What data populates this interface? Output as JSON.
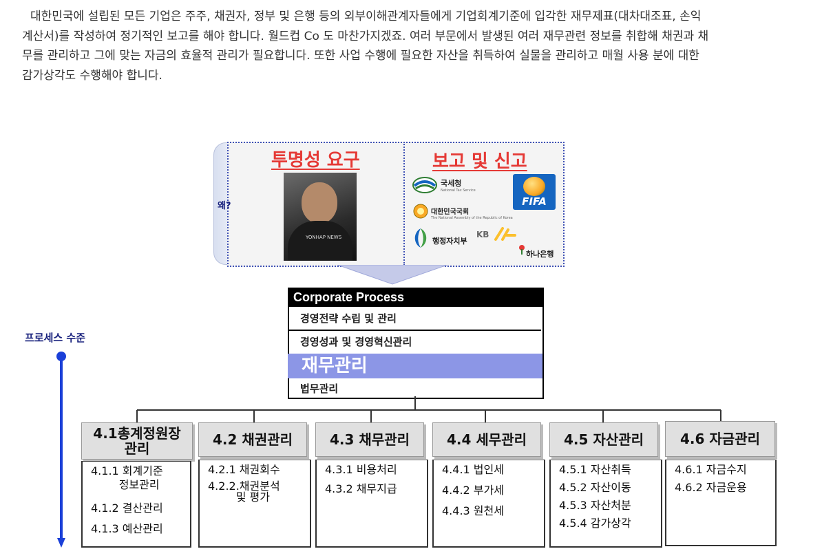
{
  "intro": {
    "lines": [
      "대한민국에  설립된 모든 기업은 주주, 채권자, 정부 및 은행 등의 외부이해관계자들에게 기업회계기준에 입각한 재무제표(대차대조표, 손익",
      "계산서)를 작성하여 정기적인 보고를 해야 합니다. 월드컵 Co 도 마찬가지겠죠. 여러 부문에서 발생된 여러 재무관련 정보를 취합해 채권과 채",
      "무를 관리하고 그에 맞는 자금의 효율적 관리가 필요합니다. 또한 사업 수행에 필요한 자산을 취득하여 실물을 관리하고 매월 사용 분에 대한",
      "감가상각도 수행해야 합니다."
    ]
  },
  "panel": {
    "why_label": "왜?",
    "left_header": "투명성 요구",
    "right_header": "보고 및 신고",
    "photo_caption": "YONHAP NEWS",
    "logos": {
      "nts": "국세청",
      "nts_en": "National Tax Service",
      "assembly": "대한민국국회",
      "assembly_en": "The National Assembly of the Republic of Korea",
      "mogaha": "행정자치부",
      "kb": "KB",
      "hana": "하나은행",
      "fifa": "FIFA"
    }
  },
  "process": {
    "title": "Corporate Process",
    "rows": [
      "경영전략 수립 및 관리",
      "경영성과 및 경영혁신관리",
      "재무관리",
      "법무관리"
    ]
  },
  "level_label": "프로세스 수준",
  "cards": [
    {
      "title": "4.1총계정원장\n관리",
      "items": [
        "4.1.1 회계기준\n        정보관리",
        "4.1.2 결산관리",
        "4.1.3 예산관리"
      ]
    },
    {
      "title": "4.2 채권관리",
      "items": [
        "4.2.1 채권회수",
        "4.2.2.채권분석\n        및 평가"
      ]
    },
    {
      "title": "4.3 채무관리",
      "items": [
        "4.3.1 비용처리",
        "4.3.2 채무지급"
      ]
    },
    {
      "title": "4.4 세무관리",
      "items": [
        "4.4.1 법인세",
        "4.4.2 부가세",
        "4.4.3 원천세"
      ]
    },
    {
      "title": "4.5 자산관리",
      "items": [
        "4.5.1 자산취득",
        "4.5.2 자산이동",
        "4.5.3 자산처분",
        "4.5.4 감가상각"
      ]
    },
    {
      "title": "4.6 자금관리",
      "items": [
        "4.6.1 자금수지",
        "4.6.2 자금운용"
      ]
    }
  ],
  "colors": {
    "accent_red": "#e53935",
    "accent_blue": "#1a237e",
    "highlight": "#8c96e6",
    "arrow_blue": "#1a3fd8"
  }
}
